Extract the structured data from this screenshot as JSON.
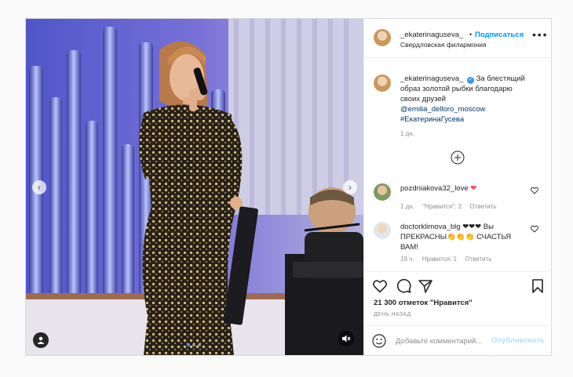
{
  "header": {
    "username": "_ekaterinaguseva_",
    "separator": "•",
    "follow_label": "Подписаться",
    "location": "Свердловская филармония",
    "more_icon": "more-horizontal-icon"
  },
  "caption": {
    "username": "_ekaterinaguseva_",
    "verified_mark": "✓",
    "text": "За блестящий образ золотой рыбки благодарю своих друзей",
    "mention": "@emilia_delloro_moscow",
    "hashtag": "#ЕкатеринаГусева",
    "time": "1 дн."
  },
  "comments": [
    {
      "username": "pozdniakova32_love",
      "text": "❤",
      "time": "1 дн.",
      "likes": "\"Нравится\": 2",
      "reply": "Ответить"
    },
    {
      "username": "doctorklimova_blg",
      "text": "❤❤❤ Вы ПРЕКРАСНЫ👏👏👏 СЧАСТЬЯ ВАМ!",
      "time": "19 ч.",
      "likes": "Нравится: 1",
      "reply": "Ответить"
    }
  ],
  "actions": {
    "likes_text": "21 300 отметок \"Нравится\"",
    "posted_ago": "ДЕНЬ НАЗАД"
  },
  "add_comment": {
    "placeholder": "Добавьте комментарий...",
    "publish_label": "Опубликовать"
  },
  "colors": {
    "accent": "#0095f6",
    "like_red": "#ed4956",
    "muted": "#8e8e8e"
  }
}
